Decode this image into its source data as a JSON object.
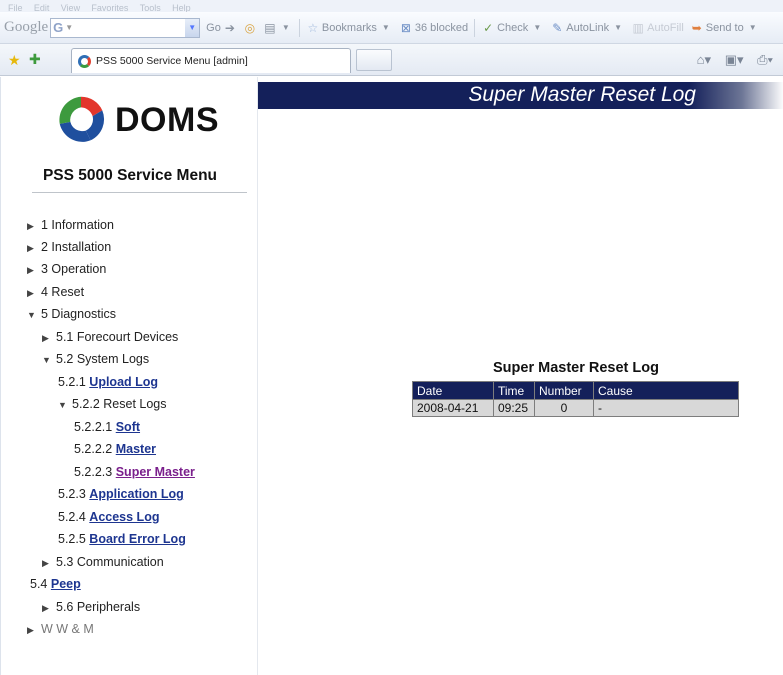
{
  "browser": {
    "menu": [
      "File",
      "Edit",
      "View",
      "Favorites",
      "Tools",
      "Help"
    ],
    "google_label": "Google",
    "google_box": "G",
    "toolbar": {
      "go": "Go",
      "bookmarks": "Bookmarks",
      "blocked": "36 blocked",
      "check": "Check",
      "autolink": "AutoLink",
      "autofill": "AutoFill",
      "send_to": "Send to"
    },
    "tab_title": "PSS 5000 Service Menu [admin]"
  },
  "sidebar": {
    "logo_text": "DOMS",
    "title": "PSS 5000 Service Menu",
    "nav": [
      {
        "num": "1 Information",
        "arrow": "▶"
      },
      {
        "num": "2 Installation",
        "arrow": "▶"
      },
      {
        "num": "3 Operation",
        "arrow": "▶"
      },
      {
        "num": "4 Reset",
        "arrow": "▶"
      },
      {
        "num": "5 Diagnostics",
        "arrow": "▼"
      },
      {
        "num": "5.1 Forecourt Devices",
        "arrow": "▶"
      },
      {
        "num": "5.2 System Logs",
        "arrow": "▼"
      },
      {
        "num": "5.2.1",
        "link": "Upload Log"
      },
      {
        "num": "5.2.2 Reset Logs",
        "arrow": "▼"
      },
      {
        "num": "5.2.2.1",
        "link": "Soft"
      },
      {
        "num": "5.2.2.2",
        "link": "Master"
      },
      {
        "num": "5.2.2.3",
        "link": "Super Master"
      },
      {
        "num": "5.2.3",
        "link": "Application Log"
      },
      {
        "num": "5.2.4",
        "link": "Access Log"
      },
      {
        "num": "5.2.5",
        "link": "Board Error Log"
      },
      {
        "num": "5.3 Communication",
        "arrow": "▶"
      },
      {
        "num": "5.4",
        "link": "Peep"
      },
      {
        "num": "5.6 Peripherals",
        "arrow": "▶"
      },
      {
        "num": "W W & M",
        "arrow": "▶"
      }
    ]
  },
  "main": {
    "banner_title": "Super Master Reset Log",
    "log_title": "Super Master Reset Log",
    "table": {
      "headers": [
        "Date",
        "Time",
        "Number",
        "Cause"
      ],
      "rows": [
        [
          "2008-04-21",
          "09:25",
          "0",
          "-"
        ]
      ]
    }
  },
  "colors": {
    "banner": "#14205a",
    "link": "#1d3590",
    "visited_link": "#7a1f8c",
    "table_header": "#14205a",
    "table_cell": "#d8d8d8"
  }
}
